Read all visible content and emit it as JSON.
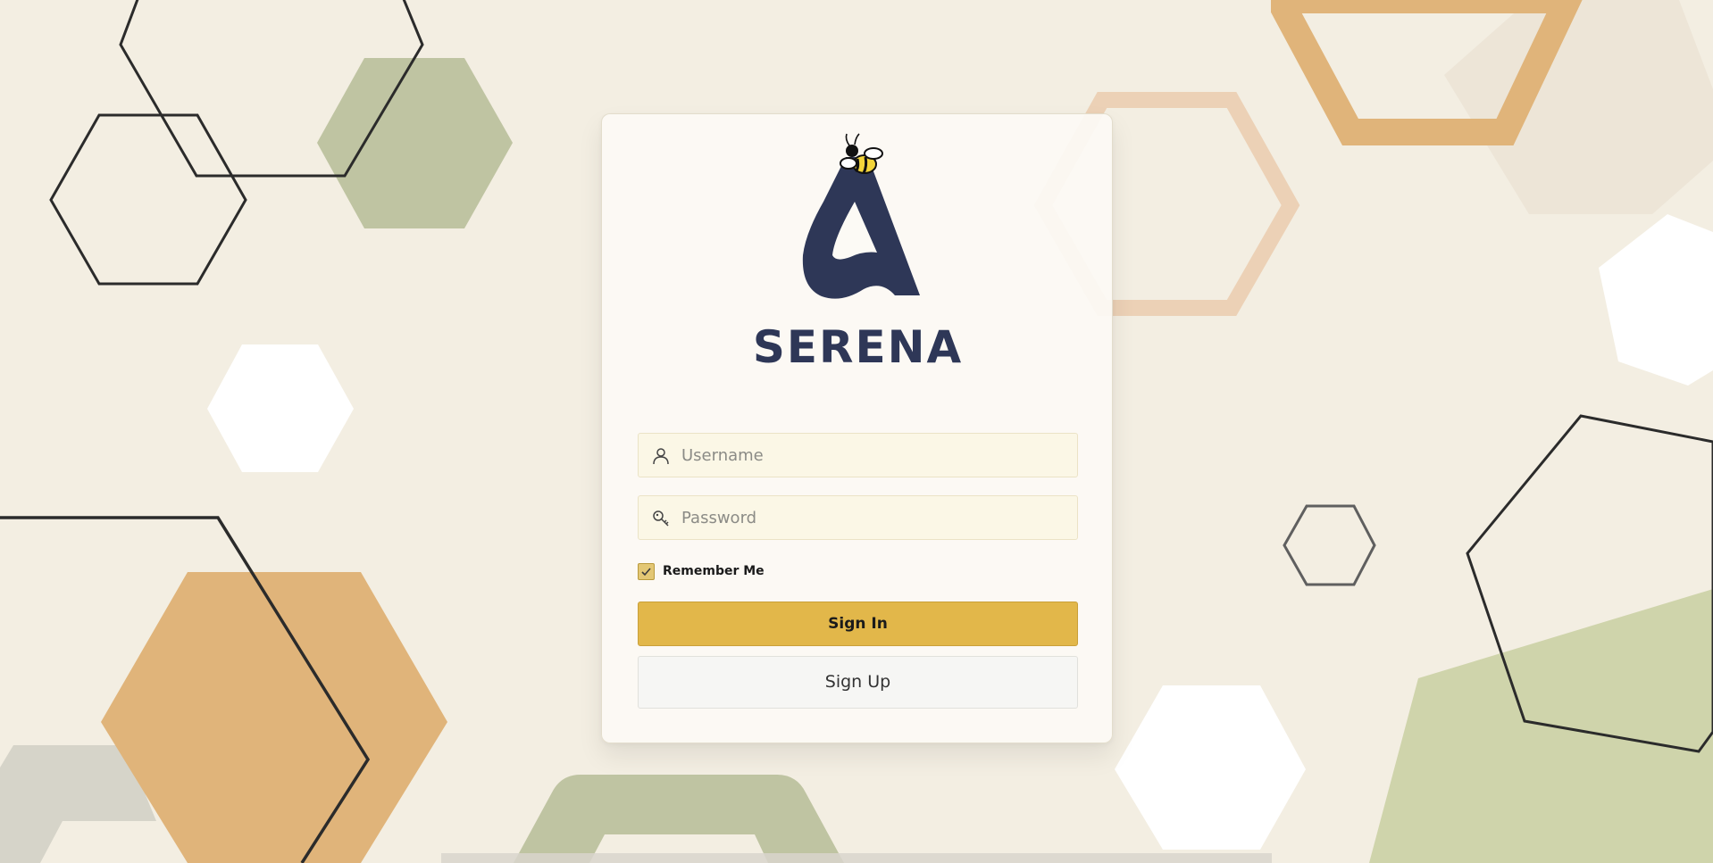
{
  "app": {
    "brand_name": "SERENA",
    "logo_icon": "serena-bee-logo-icon"
  },
  "login": {
    "username": {
      "placeholder": "Username",
      "value": "",
      "icon": "user-icon"
    },
    "password": {
      "placeholder": "Password",
      "value": "",
      "icon": "key-icon"
    },
    "remember_me": {
      "label": "Remember Me",
      "checked": true
    },
    "sign_in_label": "Sign In",
    "sign_up_label": "Sign Up"
  },
  "colors": {
    "background": "#f3eee2",
    "brand_navy": "#2e3757",
    "accent_gold": "#e2b74a",
    "input_bg": "#fbf7e6",
    "hex_olive": "#bfc4a2",
    "hex_tan": "#e0b47a"
  }
}
